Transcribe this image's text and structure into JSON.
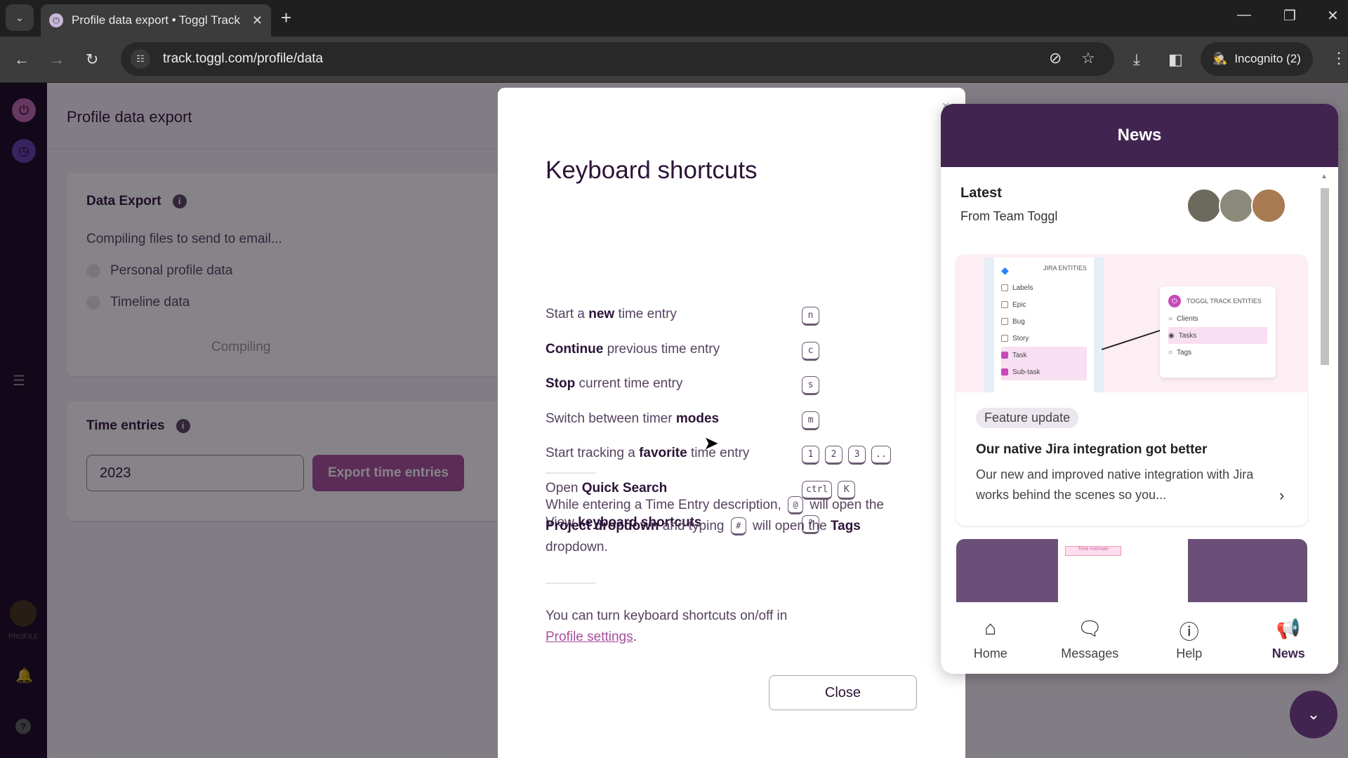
{
  "browser": {
    "tab_title": "Profile data export • Toggl Track",
    "url": "track.toggl.com/profile/data",
    "incognito_label": "Incognito (2)"
  },
  "sidebar": {
    "profile_label": "PROFILE"
  },
  "page": {
    "title": "Profile data export",
    "data_export": {
      "heading": "Data Export",
      "status": "Compiling files to send to email...",
      "options": [
        "Personal profile data",
        "Timeline data"
      ],
      "button_label": "Compiling"
    },
    "time_entries": {
      "heading": "Time entries",
      "year_value": "2023",
      "export_button": "Export time entries"
    }
  },
  "modal": {
    "title": "Keyboard shortcuts",
    "shortcuts": [
      {
        "pre": "Start a ",
        "bold": "new",
        "post": " time entry",
        "keys": [
          "n"
        ]
      },
      {
        "pre": "",
        "bold": "Continue",
        "post": " previous time entry",
        "keys": [
          "c"
        ]
      },
      {
        "pre": "",
        "bold": "Stop",
        "post": " current time entry",
        "keys": [
          "s"
        ]
      },
      {
        "pre": "Switch between timer ",
        "bold": "modes",
        "post": "",
        "keys": [
          "m"
        ]
      },
      {
        "pre": "Start tracking a ",
        "bold": "favorite",
        "post": " time entry",
        "keys": [
          "1",
          "2",
          "3",
          ".."
        ]
      },
      {
        "pre": "Open ",
        "bold": "Quick Search",
        "post": "",
        "keys": [
          "ctrl",
          "K"
        ]
      },
      {
        "pre": "View ",
        "bold": "keyboard shortcuts",
        "post": "",
        "keys": [
          "?"
        ]
      }
    ],
    "tip": {
      "p1": "While entering a Time Entry description,",
      "key1": "@",
      "p2": "will open the",
      "b1": "Project dropdown",
      "p3": "and typing",
      "key2": "#",
      "p4": "will open the",
      "b2": "Tags",
      "p5": "dropdown."
    },
    "settings_note": "You can turn keyboard shortcuts on/off in",
    "settings_link": "Profile settings",
    "close_label": "Close"
  },
  "news": {
    "header": "News",
    "latest": "Latest",
    "from": "From Team Toggl",
    "card": {
      "jira_heading": "JIRA ENTITIES",
      "jira_items": [
        {
          "label": "Labels",
          "checked": false
        },
        {
          "label": "Epic",
          "checked": false
        },
        {
          "label": "Bug",
          "checked": false
        },
        {
          "label": "Story",
          "checked": false
        },
        {
          "label": "Task",
          "checked": true
        },
        {
          "label": "Sub-task",
          "checked": true
        }
      ],
      "toggl_heading": "TOGGL TRACK ENTITIES",
      "toggl_items": [
        {
          "label": "Clients",
          "selected": false
        },
        {
          "label": "Tasks",
          "selected": true
        },
        {
          "label": "Tags",
          "selected": false
        }
      ],
      "badge": "Feature update",
      "title": "Our native Jira integration got better",
      "description": "Our new and improved native integration with Jira works behind the scenes so you..."
    },
    "card2_preview": {
      "tab": "Time estimate"
    },
    "footer": [
      {
        "label": "Home",
        "icon": "home-icon"
      },
      {
        "label": "Messages",
        "icon": "messages-icon"
      },
      {
        "label": "Help",
        "icon": "help-icon"
      },
      {
        "label": "News",
        "icon": "megaphone-icon",
        "active": true
      }
    ]
  },
  "colors": {
    "brand_dark": "#412450",
    "accent": "#a64f9a",
    "sidebar": "#2c1338"
  }
}
